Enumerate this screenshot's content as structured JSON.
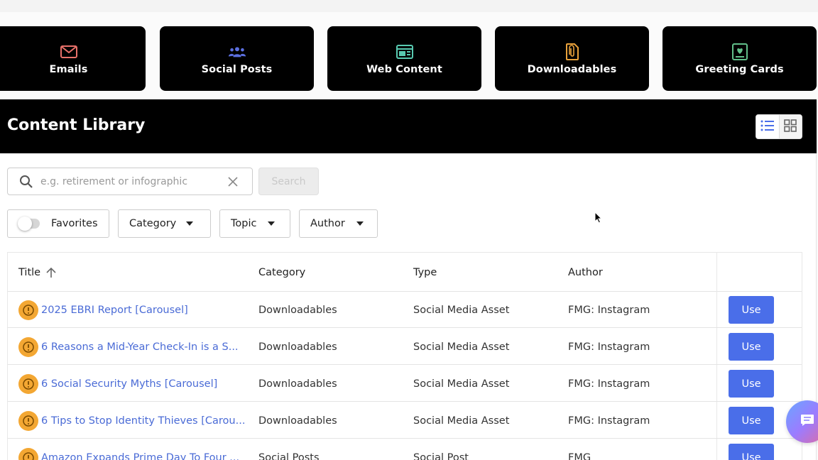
{
  "tiles": [
    {
      "label": "Emails",
      "icon": "envelope-icon",
      "color": "#e8716a"
    },
    {
      "label": "Social Posts",
      "icon": "people-icon",
      "color": "#5b6fe0"
    },
    {
      "label": "Web Content",
      "icon": "browser-window-icon",
      "color": "#58c9b0"
    },
    {
      "label": "Downloadables",
      "icon": "paperclip-document-icon",
      "color": "#e9a23b"
    },
    {
      "label": "Greeting Cards",
      "icon": "card-icon",
      "color": "#62c08a"
    }
  ],
  "library": {
    "title": "Content Library",
    "view_modes": [
      "list-icon",
      "grid-icon"
    ]
  },
  "search": {
    "placeholder": "e.g. retirement or infographic",
    "value": "",
    "button_label": "Search"
  },
  "filters": {
    "favorites_label": "Favorites",
    "category_label": "Category",
    "topic_label": "Topic",
    "author_label": "Author"
  },
  "table": {
    "columns": {
      "title": "Title",
      "category": "Category",
      "type": "Type",
      "author": "Author"
    },
    "use_label": "Use",
    "rows": [
      {
        "title": "2025 EBRI Report [Carousel]",
        "category": "Downloadables",
        "type": "Social Media Asset",
        "author": "FMG: Instagram"
      },
      {
        "title": "6 Reasons a Mid-Year Check-In is a S...",
        "category": "Downloadables",
        "type": "Social Media Asset",
        "author": "FMG: Instagram"
      },
      {
        "title": "6 Social Security Myths [Carousel]",
        "category": "Downloadables",
        "type": "Social Media Asset",
        "author": "FMG: Instagram"
      },
      {
        "title": "6 Tips to Stop Identity Thieves [Carou...",
        "category": "Downloadables",
        "type": "Social Media Asset",
        "author": "FMG: Instagram"
      },
      {
        "title": "Amazon Expands Prime Day To Four ...",
        "category": "Social Posts",
        "type": "Social Post",
        "author": "FMG"
      }
    ]
  },
  "colors": {
    "accent": "#4a6ee9",
    "link": "#4a6bd6",
    "warning": "#f3a733"
  }
}
